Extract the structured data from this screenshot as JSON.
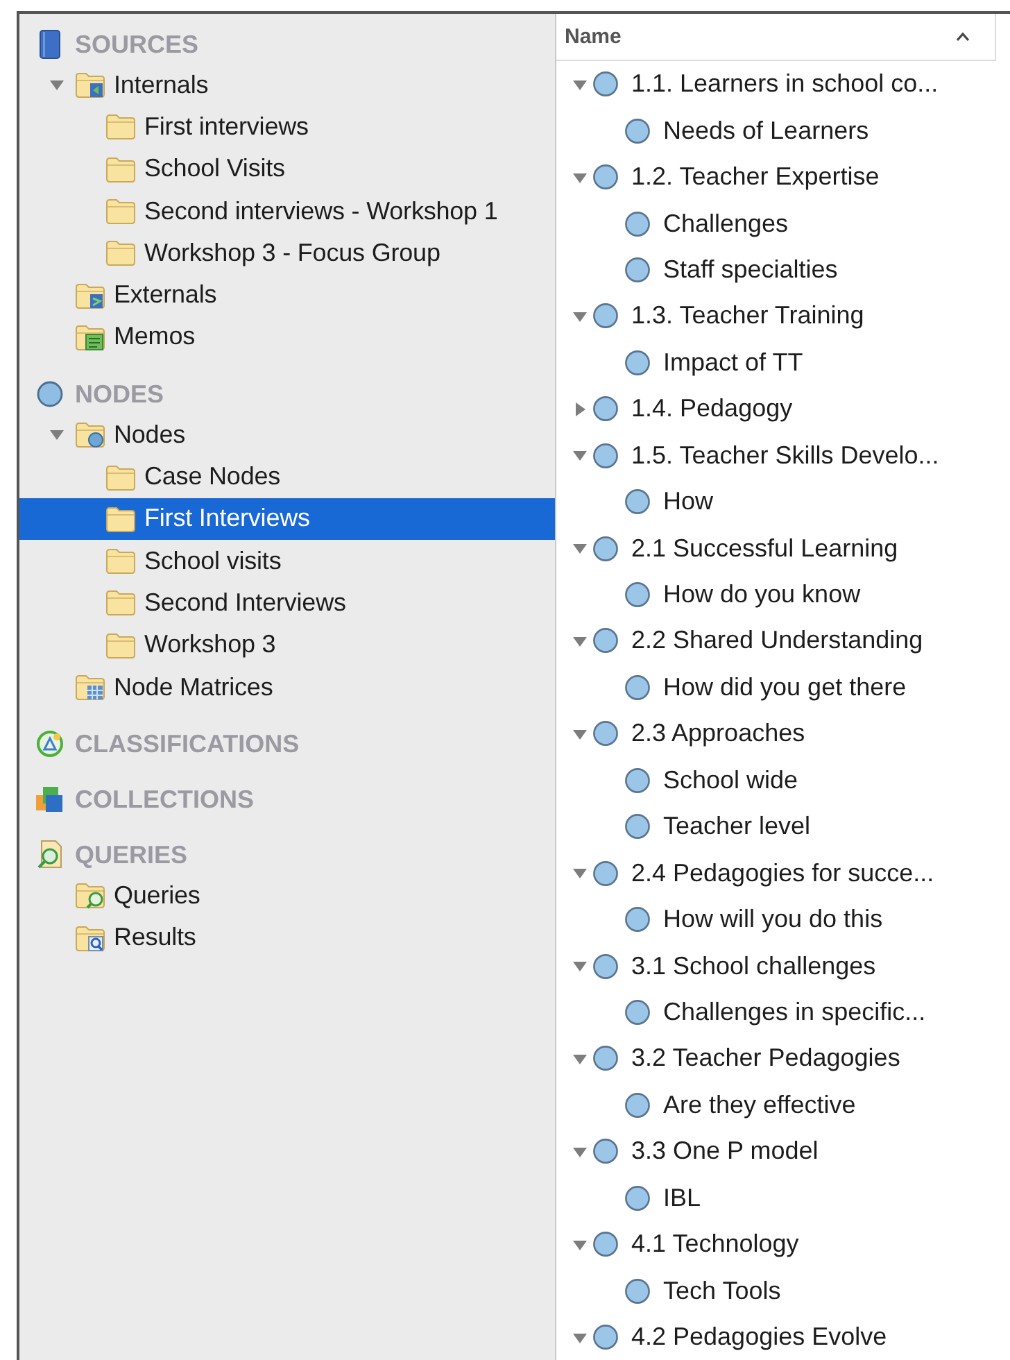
{
  "sidebar": {
    "sections": [
      {
        "title": "SOURCES",
        "kind": "sources",
        "items": [
          {
            "label": "Internals",
            "kind": "internals",
            "expanded": true,
            "selected": false,
            "children": [
              {
                "label": "First interviews",
                "kind": "folder",
                "selected": false
              },
              {
                "label": "School Visits",
                "kind": "folder",
                "selected": false
              },
              {
                "label": "Second interviews - Workshop 1",
                "kind": "folder",
                "selected": false
              },
              {
                "label": "Workshop 3 - Focus Group",
                "kind": "folder",
                "selected": false
              }
            ]
          },
          {
            "label": "Externals",
            "kind": "externals",
            "selected": false
          },
          {
            "label": "Memos",
            "kind": "memos",
            "selected": false
          }
        ]
      },
      {
        "title": "NODES",
        "kind": "nodes",
        "items": [
          {
            "label": "Nodes",
            "kind": "nodes",
            "expanded": true,
            "selected": false,
            "children": [
              {
                "label": "Case Nodes",
                "kind": "folder",
                "selected": false
              },
              {
                "label": "First Interviews",
                "kind": "folder",
                "selected": true
              },
              {
                "label": "School visits",
                "kind": "folder",
                "selected": false
              },
              {
                "label": "Second Interviews",
                "kind": "folder",
                "selected": false
              },
              {
                "label": "Workshop 3",
                "kind": "folder",
                "selected": false
              }
            ]
          },
          {
            "label": "Node Matrices",
            "kind": "matrices",
            "selected": false
          }
        ]
      },
      {
        "title": "CLASSIFICATIONS",
        "kind": "classifications"
      },
      {
        "title": "COLLECTIONS",
        "kind": "collections"
      },
      {
        "title": "QUERIES",
        "kind": "queries",
        "items": [
          {
            "label": "Queries",
            "kind": "queries",
            "selected": false
          },
          {
            "label": "Results",
            "kind": "results",
            "selected": false
          }
        ]
      }
    ]
  },
  "node_list": {
    "column": "Name",
    "nodes": [
      {
        "label": "1.1. Learners in school co...",
        "expanded": true,
        "children": [
          {
            "label": "Needs of Learners"
          }
        ]
      },
      {
        "label": "1.2. Teacher Expertise",
        "expanded": true,
        "children": [
          {
            "label": "Challenges"
          },
          {
            "label": "Staff specialties"
          }
        ]
      },
      {
        "label": "1.3. Teacher Training",
        "expanded": true,
        "children": [
          {
            "label": "Impact of TT"
          }
        ]
      },
      {
        "label": "1.4. Pedagogy",
        "expanded": false
      },
      {
        "label": "1.5. Teacher Skills Develo...",
        "expanded": true,
        "children": [
          {
            "label": "How"
          }
        ]
      },
      {
        "label": "2.1 Successful Learning",
        "expanded": true,
        "children": [
          {
            "label": "How do you know"
          }
        ]
      },
      {
        "label": "2.2 Shared Understanding",
        "expanded": true,
        "children": [
          {
            "label": "How did you get there"
          }
        ]
      },
      {
        "label": "2.3 Approaches",
        "expanded": true,
        "children": [
          {
            "label": "School wide"
          },
          {
            "label": "Teacher level"
          }
        ]
      },
      {
        "label": "2.4 Pedagogies for succe...",
        "expanded": true,
        "children": [
          {
            "label": "How will you do this"
          }
        ]
      },
      {
        "label": "3.1 School challenges",
        "expanded": true,
        "children": [
          {
            "label": "Challenges in specific..."
          }
        ]
      },
      {
        "label": "3.2 Teacher Pedagogies",
        "expanded": true,
        "children": [
          {
            "label": "Are they effective"
          }
        ]
      },
      {
        "label": "3.3 One P model",
        "expanded": true,
        "children": [
          {
            "label": "IBL"
          }
        ]
      },
      {
        "label": "4.1 Technology",
        "expanded": true,
        "children": [
          {
            "label": "Tech Tools"
          }
        ]
      },
      {
        "label": "4.2 Pedagogies Evolve",
        "expanded": true
      }
    ]
  }
}
